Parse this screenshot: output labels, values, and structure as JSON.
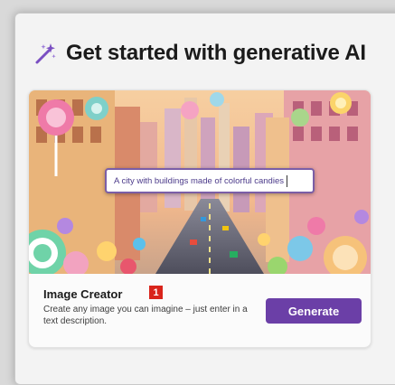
{
  "section": {
    "title": "Get started with generative AI",
    "icon": "magic-wand-sparkle-icon"
  },
  "card": {
    "prompt_text": "A city with buildings made of colorful candies",
    "title": "Image Creator",
    "badge": "1",
    "description": "Create any image you can imagine – just enter in a text description.",
    "button_label": "Generate"
  },
  "colors": {
    "accent": "#6b3fa7",
    "badge": "#d9241b",
    "panel_bg": "#f3f3f3"
  }
}
